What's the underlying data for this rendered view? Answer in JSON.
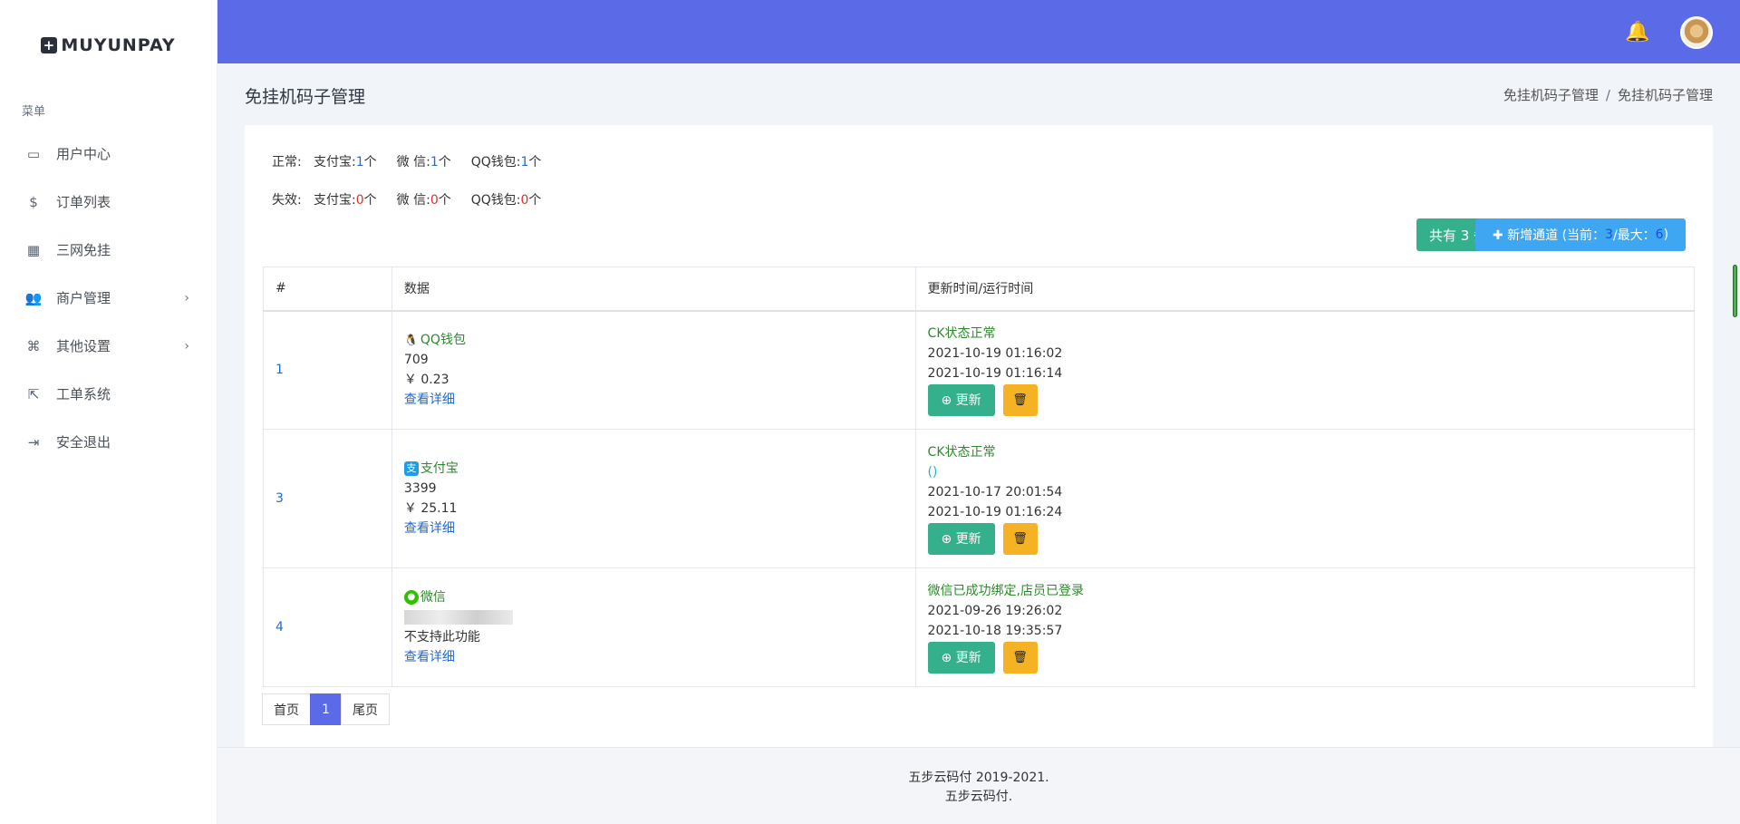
{
  "brand": {
    "name": "MUYUNPAY",
    "mark": "+"
  },
  "sidebar": {
    "section_title": "菜单",
    "items": [
      {
        "label": "用户中心",
        "icon": "monitor-icon",
        "glyph": "▭",
        "has_arrow": false
      },
      {
        "label": "订单列表",
        "icon": "dollar-icon",
        "glyph": "$",
        "has_arrow": false
      },
      {
        "label": "三网免挂",
        "icon": "qrcode-icon",
        "glyph": "▦",
        "has_arrow": false
      },
      {
        "label": "商户管理",
        "icon": "users-icon",
        "glyph": "👥",
        "has_arrow": true
      },
      {
        "label": "其他设置",
        "icon": "command-icon",
        "glyph": "⌘",
        "has_arrow": true
      },
      {
        "label": "工单系统",
        "icon": "share-icon",
        "glyph": "⇱",
        "has_arrow": false
      },
      {
        "label": "安全退出",
        "icon": "logout-icon",
        "glyph": "⇥",
        "has_arrow": false
      }
    ],
    "arrow": "›"
  },
  "header": {
    "bell_glyph": "🔔"
  },
  "page": {
    "title": "免挂机码子管理",
    "breadcrumb": [
      "免挂机码子管理",
      "免挂机码子管理"
    ],
    "breadcrumb_sep": "/"
  },
  "stats": {
    "normal": {
      "label": "正常:",
      "alipay_label": "支付宝:",
      "alipay": "1",
      "wechat_label": "微 信:",
      "wechat": "1",
      "qq_label": "QQ钱包:",
      "qq": "1",
      "unit": "个"
    },
    "invalid": {
      "label": "失效:",
      "alipay_label": "支付宝:",
      "alipay": "0",
      "wechat_label": "微 信:",
      "wechat": "0",
      "qq_label": "QQ钱包:",
      "qq": "0",
      "unit": "个"
    }
  },
  "buttons": {
    "total": "共有 3 条记录",
    "add_prefix": "✚ 新增通道 (当前：",
    "add_current": "3",
    "add_mid": "/最大：",
    "add_max": "6",
    "add_suffix": ")"
  },
  "table": {
    "headers": [
      "#",
      "数据",
      "更新时间/运行时间"
    ],
    "rows": [
      {
        "index": "1",
        "type_label": "QQ钱包",
        "type_icon": "qq-icon",
        "account": "709",
        "amount": "￥ 0.23",
        "detail": "查看详细",
        "status": "CK状态正常",
        "extra": "",
        "time1": "2021-10-19 01:16:02",
        "time2": "2021-10-19 01:16:14"
      },
      {
        "index": "3",
        "type_label": "支付宝",
        "type_icon": "alipay-icon",
        "account": "3399",
        "amount": "￥ 25.11",
        "detail": "查看详细",
        "status": "CK状态正常",
        "extra": "()",
        "time1": "2021-10-17 20:01:54",
        "time2": "2021-10-19 01:16:24"
      },
      {
        "index": "4",
        "type_label": "微信",
        "type_icon": "wechat-icon",
        "account": "",
        "amount": "不支持此功能",
        "detail": "查看详细",
        "status": "微信已成功绑定,店员已登录",
        "extra": "",
        "time1": "2021-09-26 19:26:02",
        "time2": "2021-10-18 19:35:57"
      }
    ],
    "update_label": "⊕ 更新",
    "delete_glyph": "🗑"
  },
  "pagination": {
    "first": "首页",
    "current": "1",
    "last": "尾页"
  },
  "footer": {
    "line1": "五步云码付 2019-2021.",
    "line2": "五步云码付."
  },
  "colors": {
    "header": "#5b6be8",
    "success": "#34b08c",
    "info": "#3fa6f2",
    "warning": "#f5b225",
    "link": "#1e6bd6"
  }
}
